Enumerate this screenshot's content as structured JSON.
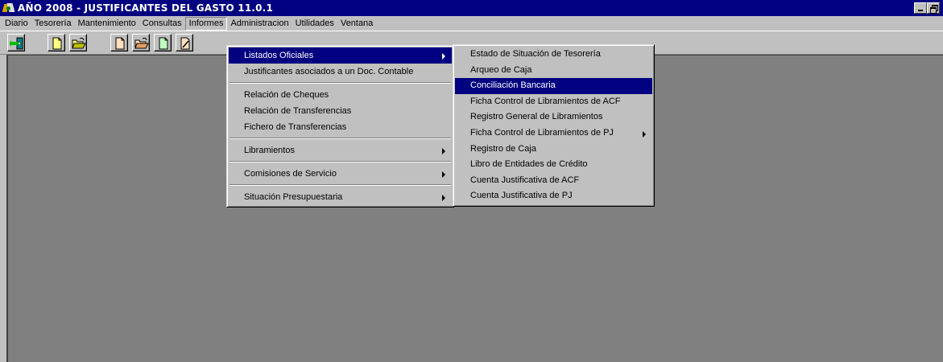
{
  "window": {
    "title": "AÑO 2008 - JUSTIFICANTES DEL GASTO 11.0.1",
    "title_bar_color": "#000080",
    "client_bg_color": "#808080",
    "app_icon": "app-logo-icon",
    "controls": [
      "minimize-icon",
      "restore-icon"
    ]
  },
  "menubar": {
    "items": [
      {
        "label": "Diario"
      },
      {
        "label": "Tesorería"
      },
      {
        "label": "Mantenimiento"
      },
      {
        "label": "Consultas"
      },
      {
        "label": "Informes",
        "open": true
      },
      {
        "label": "Administracion"
      },
      {
        "label": "Utilidades"
      },
      {
        "label": "Ventana"
      }
    ]
  },
  "toolbar": {
    "buttons": [
      {
        "icon": "exit-door-icon"
      },
      {
        "icon": "new-document-icon"
      },
      {
        "icon": "open-folder-icon"
      },
      {
        "icon": "new-document-icon"
      },
      {
        "icon": "open-folder-icon"
      },
      {
        "icon": "document-icon"
      },
      {
        "icon": "edit-document-icon"
      }
    ]
  },
  "informes_menu": {
    "items": [
      {
        "label": "Listados Oficiales",
        "submenu": true,
        "highlighted": true
      },
      {
        "label": "Justificantes asociados a un Doc. Contable"
      },
      {
        "separator": true
      },
      {
        "label": "Relación de Cheques"
      },
      {
        "label": "Relación de Transferencias"
      },
      {
        "label": "Fichero de Transferencias"
      },
      {
        "separator": true
      },
      {
        "label": "Libramientos",
        "submenu": true
      },
      {
        "separator": true
      },
      {
        "label": "Comisiones de Servicio",
        "submenu": true
      },
      {
        "separator": true
      },
      {
        "label": "Situación Presupuestaria",
        "submenu": true
      }
    ]
  },
  "listados_menu": {
    "items": [
      {
        "label": "Estado de Situación de Tesorería"
      },
      {
        "label": "Arqueo de Caja"
      },
      {
        "label": "Conciliación Bancaria",
        "highlighted": true
      },
      {
        "label": "Ficha Control de Libramientos de ACF"
      },
      {
        "label": "Registro General de Libramientos"
      },
      {
        "label": "Ficha Control de Libramientos de PJ",
        "submenu": true
      },
      {
        "label": "Registro de Caja"
      },
      {
        "label": "Libro de Entidades de Crédito"
      },
      {
        "label": "Cuenta Justificativa de ACF"
      },
      {
        "label": "Cuenta Justificativa de PJ"
      }
    ]
  }
}
